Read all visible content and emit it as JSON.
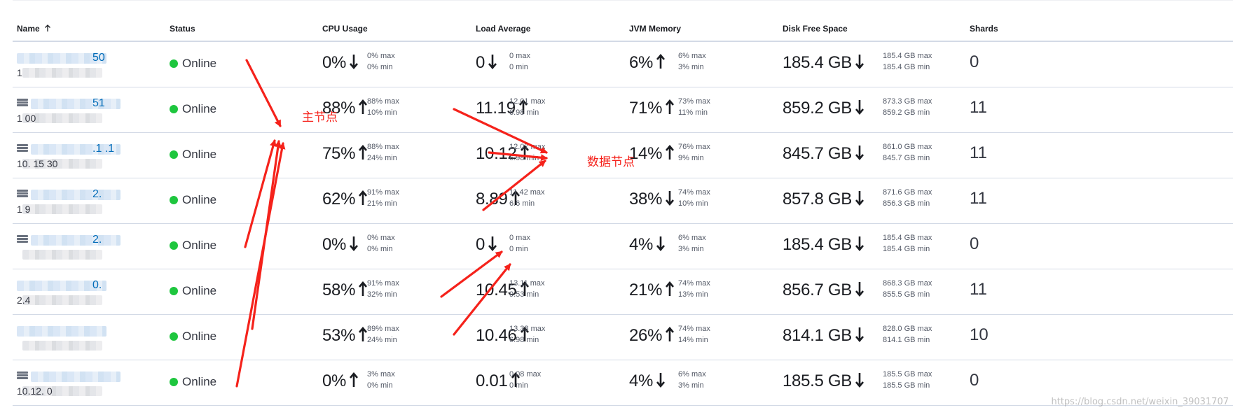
{
  "columns": {
    "name": "Name",
    "status": "Status",
    "cpu": "CPU Usage",
    "load": "Load Average",
    "jvm": "JVM Memory",
    "disk": "Disk Free Space",
    "shards": "Shards"
  },
  "sort": {
    "column": "name",
    "direction": "ascending",
    "icon": "arrow-up-icon"
  },
  "rows": [
    {
      "name": "50",
      "ip": "1",
      "node_icon": false,
      "status": "Online",
      "cpu": {
        "value": "0%",
        "trend": "down",
        "max": "0% max",
        "min": "0% min"
      },
      "load": {
        "value": "0",
        "trend": "down",
        "max": "0 max",
        "min": "0 min"
      },
      "jvm": {
        "value": "6%",
        "trend": "up",
        "max": "6% max",
        "min": "3% min"
      },
      "disk": {
        "value": "185.4 GB",
        "trend": "down",
        "max": "185.4 GB max",
        "min": "185.4 GB min"
      },
      "shards": "0"
    },
    {
      "name": "51",
      "ip": "1 00",
      "node_icon": true,
      "status": "Online",
      "cpu": {
        "value": "88%",
        "trend": "up",
        "max": "88% max",
        "min": "10% min"
      },
      "load": {
        "value": "11.19",
        "trend": "up",
        "max": "12.01 max",
        "min": "6.98 min"
      },
      "jvm": {
        "value": "71%",
        "trend": "up",
        "max": "73% max",
        "min": "11% min"
      },
      "disk": {
        "value": "859.2 GB",
        "trend": "down",
        "max": "873.3 GB max",
        "min": "859.2 GB min"
      },
      "shards": "11"
    },
    {
      "name": ".1  .1",
      "ip": "10. 15 30",
      "node_icon": true,
      "status": "Online",
      "cpu": {
        "value": "75%",
        "trend": "up",
        "max": "88% max",
        "min": "24% min"
      },
      "load": {
        "value": "10.12",
        "trend": "up",
        "max": "12.07 max",
        "min": "6.98 min"
      },
      "jvm": {
        "value": "14%",
        "trend": "up",
        "max": "76% max",
        "min": "9% min"
      },
      "disk": {
        "value": "845.7 GB",
        "trend": "down",
        "max": "861.0 GB max",
        "min": "845.7 GB min"
      },
      "shards": "11"
    },
    {
      "name": "2.",
      "ip": "1 9",
      "node_icon": true,
      "status": "Online",
      "cpu": {
        "value": "62%",
        "trend": "up",
        "max": "91% max",
        "min": "21% min"
      },
      "load": {
        "value": "8.89",
        "trend": "up",
        "max": "11.42 max",
        "min": "6.6 min"
      },
      "jvm": {
        "value": "38%",
        "trend": "down",
        "max": "74% max",
        "min": "10% min"
      },
      "disk": {
        "value": "857.8 GB",
        "trend": "down",
        "max": "871.6 GB max",
        "min": "856.3 GB min"
      },
      "shards": "11"
    },
    {
      "name": "2.",
      "ip": "",
      "node_icon": true,
      "status": "Online",
      "cpu": {
        "value": "0%",
        "trend": "down",
        "max": "0% max",
        "min": "0% min"
      },
      "load": {
        "value": "0",
        "trend": "down",
        "max": "0 max",
        "min": "0 min"
      },
      "jvm": {
        "value": "4%",
        "trend": "down",
        "max": "6% max",
        "min": "3% min"
      },
      "disk": {
        "value": "185.4 GB",
        "trend": "down",
        "max": "185.4 GB max",
        "min": "185.4 GB min"
      },
      "shards": "0"
    },
    {
      "name": "0.",
      "ip": "2.4",
      "node_icon": false,
      "status": "Online",
      "cpu": {
        "value": "58%",
        "trend": "up",
        "max": "91% max",
        "min": "32% min"
      },
      "load": {
        "value": "10.45",
        "trend": "up",
        "max": "13.11 max",
        "min": "9.53 min"
      },
      "jvm": {
        "value": "21%",
        "trend": "up",
        "max": "74% max",
        "min": "13% min"
      },
      "disk": {
        "value": "856.7 GB",
        "trend": "down",
        "max": "868.3 GB max",
        "min": "855.5 GB min"
      },
      "shards": "11"
    },
    {
      "name": "",
      "ip": "",
      "node_icon": false,
      "status": "Online",
      "cpu": {
        "value": "53%",
        "trend": "up",
        "max": "89% max",
        "min": "24% min"
      },
      "load": {
        "value": "10.46",
        "trend": "up",
        "max": "13.38 max",
        "min": "6.98 min"
      },
      "jvm": {
        "value": "26%",
        "trend": "up",
        "max": "74% max",
        "min": "14% min"
      },
      "disk": {
        "value": "814.1 GB",
        "trend": "down",
        "max": "828.0 GB max",
        "min": "814.1 GB min"
      },
      "shards": "10"
    },
    {
      "name": "",
      "ip": "10.12. 0",
      "node_icon": true,
      "status": "Online",
      "cpu": {
        "value": "0%",
        "trend": "up",
        "max": "3% max",
        "min": "0% min"
      },
      "load": {
        "value": "0.01",
        "trend": "up",
        "max": "0.08 max",
        "min": "0 min"
      },
      "jvm": {
        "value": "4%",
        "trend": "down",
        "max": "6% max",
        "min": "3% min"
      },
      "disk": {
        "value": "185.5 GB",
        "trend": "down",
        "max": "185.5 GB max",
        "min": "185.5 GB min"
      },
      "shards": "0"
    }
  ],
  "annotations": {
    "master": "主节点",
    "data": "数据节点",
    "color": "#f5221b"
  },
  "watermark": "https://blog.csdn.net/weixin_39031707",
  "colors": {
    "online": "#1ec63e",
    "link": "#006bb8",
    "border": "#d3dae6"
  }
}
